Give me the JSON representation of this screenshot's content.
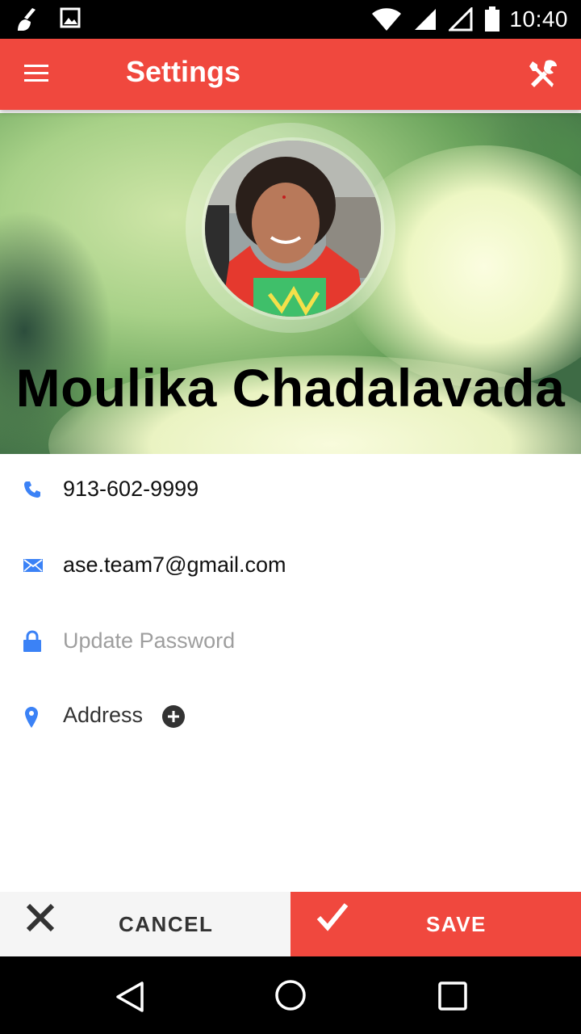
{
  "status_bar": {
    "time": "10:40",
    "icons": [
      "cleaner-icon",
      "image-icon",
      "wifi-icon",
      "signal-icon",
      "signal-empty-icon",
      "battery-icon"
    ]
  },
  "app_bar": {
    "title": "Settings",
    "menu_icon": "menu-icon",
    "action_icon": "tools-icon",
    "color": "#f0483e"
  },
  "profile": {
    "name": "Moulika Chadalavada"
  },
  "fields": [
    {
      "icon": "phone-icon",
      "value": "913-602-9999"
    },
    {
      "icon": "email-icon",
      "value": "ase.team7@gmail.com"
    },
    {
      "icon": "lock-icon",
      "placeholder": "Update Password"
    },
    {
      "icon": "location-icon",
      "value": "Address",
      "action_icon": "add-circle-icon"
    }
  ],
  "actions": {
    "cancel_label": "CANCEL",
    "save_label": "SAVE"
  },
  "nav_bar": {
    "icons": [
      "back-icon",
      "home-icon",
      "recents-icon"
    ]
  },
  "colors": {
    "accent": "#f0483e",
    "icon_blue": "#3b82f6"
  }
}
